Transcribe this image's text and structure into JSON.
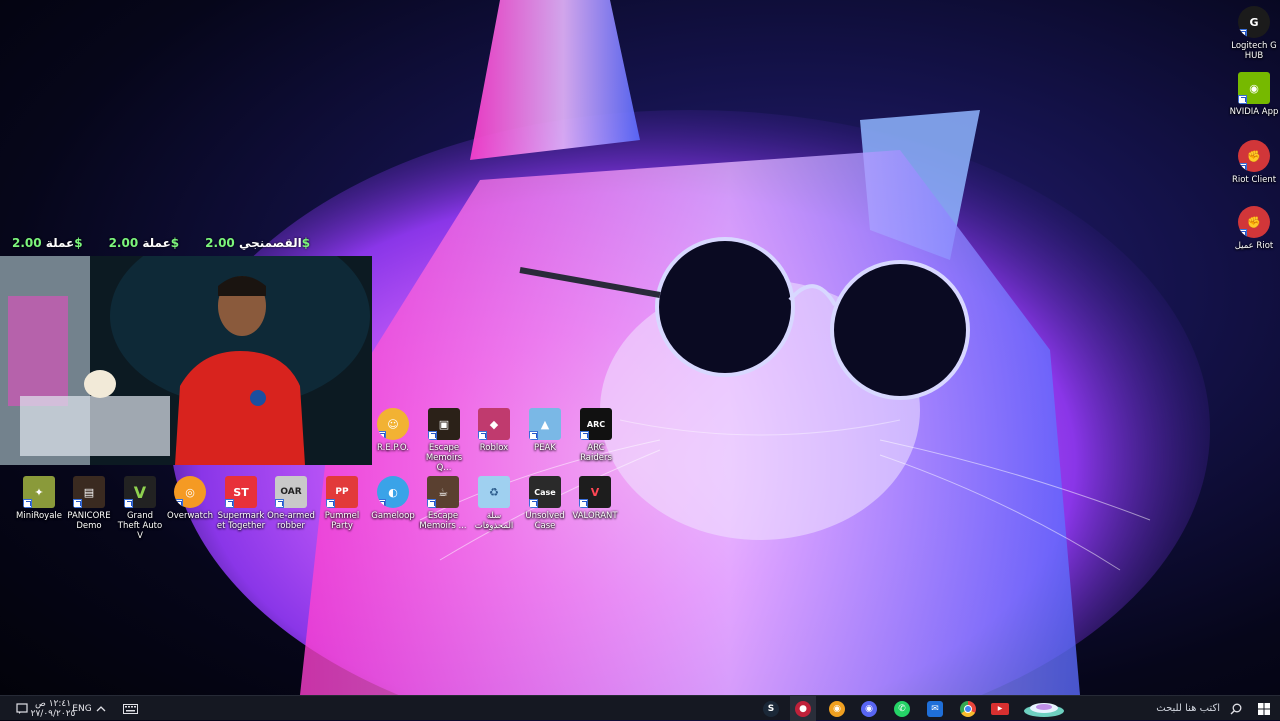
{
  "donations": [
    {
      "label": "القصمنجي",
      "amount": "2.00$"
    },
    {
      "label": "عملة",
      "amount": "2.00$"
    },
    {
      "label": "عملة",
      "amount": "2.00$"
    }
  ],
  "desktop_icons_right": [
    {
      "label": "Logitech G HUB",
      "icon": "logitech-g-icon",
      "color": "#1b1b1b"
    },
    {
      "label": "NVIDIA App",
      "icon": "nvidia-icon",
      "color": "#76b900"
    },
    {
      "label": "Riot Client",
      "icon": "riot-client-icon",
      "color": "#d13639"
    },
    {
      "label": "عميل Riot",
      "icon": "riot-client-icon",
      "color": "#d13639"
    }
  ],
  "desktop_icons_row1": [
    {
      "label": "R.E.P.O.",
      "icon": "repo-icon",
      "color": "#f2b233"
    },
    {
      "label": "Escape Memoirs Q...",
      "icon": "escape-memoirs-icon",
      "color": "#2b2118"
    },
    {
      "label": "Roblox",
      "icon": "roblox-icon",
      "color": "#c03a6e"
    },
    {
      "label": "PEAK",
      "icon": "peak-icon",
      "color": "#7ab8e6"
    },
    {
      "label": "ARC Raiders",
      "icon": "arc-raiders-icon",
      "color": "#111111"
    }
  ],
  "desktop_icons_row2": [
    {
      "label": "MiniRoyale",
      "icon": "miniroyale-icon",
      "color": "#8a9a3a"
    },
    {
      "label": "PANICORE Demo",
      "icon": "panicore-icon",
      "color": "#3a2a20"
    },
    {
      "label": "Grand Theft Auto V",
      "icon": "gta-v-icon",
      "color": "#222222"
    },
    {
      "label": "Overwatch",
      "icon": "overwatch-icon",
      "color": "#f59a23"
    },
    {
      "label": "Supermarket Together",
      "icon": "supermarket-together-icon",
      "color": "#e8313a"
    },
    {
      "label": "One-armed robber",
      "icon": "one-armed-robber-icon",
      "color": "#c9c9c9"
    },
    {
      "label": "Pummel Party",
      "icon": "pummel-party-icon",
      "color": "#e23a3a"
    },
    {
      "label": "Gameloop",
      "icon": "gameloop-icon",
      "color": "#3aa3e8"
    },
    {
      "label": "Escape Memoirs ...",
      "icon": "escape-memoirs-icon",
      "color": "#5a4030"
    },
    {
      "label": "سلة المحذوفات",
      "icon": "recycle-bin-icon",
      "color": "#9fd0f0"
    },
    {
      "label": "Unsolved Case",
      "icon": "unsolved-case-icon",
      "color": "#2a2a2a"
    },
    {
      "label": "VALORANT",
      "icon": "valorant-icon",
      "color": "#1d1d1d"
    }
  ],
  "taskbar": {
    "search_placeholder": "اكتب هنا للبحث",
    "language": "ENG",
    "time": "١٢:٤١ ص",
    "date": "٢٧/٠٩/٢٠٢٥",
    "apps": [
      {
        "name": "steam-icon",
        "color": "#1b2838"
      },
      {
        "name": "app-icon",
        "color": "#c0213a"
      },
      {
        "name": "discord-icon",
        "color": "#f0a020"
      },
      {
        "name": "discord-icon",
        "color": "#5865f2"
      },
      {
        "name": "whatsapp-icon",
        "color": "#25d366"
      },
      {
        "name": "mail-icon",
        "color": "#1f6fd8"
      },
      {
        "name": "chrome-icon",
        "color": "#e8453c"
      },
      {
        "name": "streaming-app-icon",
        "color": "#d83030"
      }
    ]
  }
}
